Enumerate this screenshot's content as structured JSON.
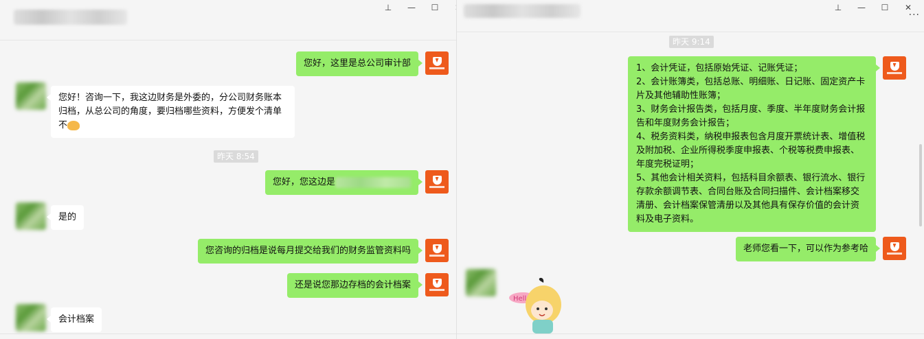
{
  "left": {
    "window_controls": [
      "⊥",
      "—",
      "☐",
      "✕"
    ],
    "messages": [
      {
        "side": "out",
        "text": "您好，这里是总公司审计部"
      },
      {
        "side": "in",
        "text": "您好！咨询一下，我这边财务是外委的，分公司财务账本归档，从总公司的角度，要归档哪些资料，方便发个清单不"
      },
      {
        "timestamp": "昨天 8:54"
      },
      {
        "side": "out",
        "text": "您好，您这边是"
      },
      {
        "side": "in",
        "text": "是的"
      },
      {
        "side": "out",
        "text": "您咨询的归档是说每月提交给我们的财务监管资料吗"
      },
      {
        "side": "out",
        "text": "还是说您那边存档的会计档案"
      },
      {
        "side": "in",
        "text": "会计档案"
      }
    ]
  },
  "right": {
    "window_controls": [
      "⊥",
      "—",
      "☐",
      "✕"
    ],
    "more_label": "···",
    "timestamp": "昨天 9:14",
    "list_message": [
      "1、会计凭证，包括原始凭证、记账凭证；",
      "2、会计账簿类，包括总账、明细账、日记账、固定资产卡片及其他辅助性账簿；",
      "3、财务会计报告类，包括月度、季度、半年度财务会计报告和年度财务会计报告；",
      "4、税务资料类，纳税申报表包含月度开票统计表、增值税及附加税、企业所得税季度申报表、个税等税费申报表、年度完税证明；",
      "5、其他会计相关资料，包括科目余额表、银行流水、银行存款余额调节表、合同台账及合同扫描件、会计档案移交清册、会计档案保管清册以及其他具有保存价值的会计资料及电子资料。"
    ],
    "reply": "老师您看一下，可以作为参考哈",
    "sticker_label": "Hello"
  }
}
